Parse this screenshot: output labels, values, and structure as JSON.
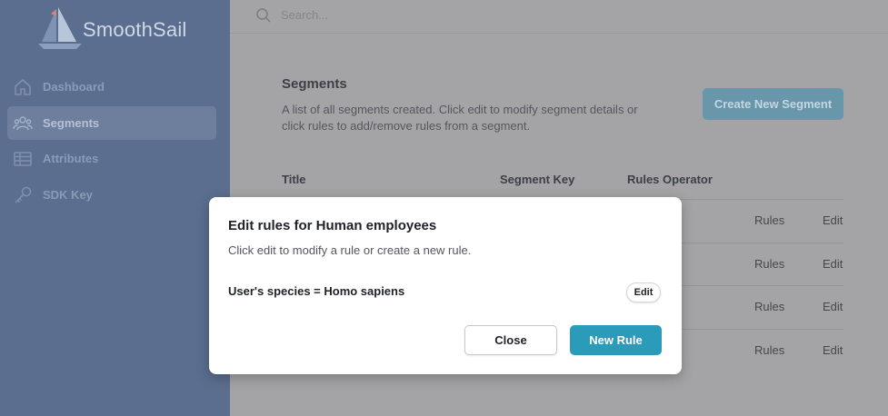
{
  "brand": {
    "name": "SmoothSail",
    "logo_icon": "sailboat-icon"
  },
  "sidebar": {
    "items": [
      {
        "label": "Dashboard",
        "icon": "home-icon",
        "active": false
      },
      {
        "label": "Segments",
        "icon": "users-icon",
        "active": true
      },
      {
        "label": "Attributes",
        "icon": "table-icon",
        "active": false
      },
      {
        "label": "SDK Key",
        "icon": "key-icon",
        "active": false
      }
    ]
  },
  "search": {
    "placeholder": "Search..."
  },
  "page": {
    "title": "Segments",
    "description": "A list of all segments created. Click edit to modify segment details or click rules to add/remove rules from a segment.",
    "create_button": "Create New Segment"
  },
  "table": {
    "headers": [
      "Title",
      "Segment Key",
      "Rules Operator"
    ],
    "row_actions": [
      {
        "rules": "Rules",
        "edit": "Edit"
      },
      {
        "rules": "Rules",
        "edit": "Edit"
      },
      {
        "rules": "Rules",
        "edit": "Edit"
      },
      {
        "rules": "Rules",
        "edit": "Edit"
      }
    ]
  },
  "modal": {
    "title": "Edit rules for Human employees",
    "description": "Click edit to modify a rule or create a new rule.",
    "rules": [
      {
        "text": "User's species = Homo sapiens",
        "edit_label": "Edit"
      }
    ],
    "close_label": "Close",
    "new_rule_label": "New Rule"
  },
  "colors": {
    "sidebar_bg": "#5b6e8f",
    "overlay_bg": "#a4a4a6",
    "primary_button": "#2a9bb8",
    "create_button_dimmed": "#6896ab"
  }
}
